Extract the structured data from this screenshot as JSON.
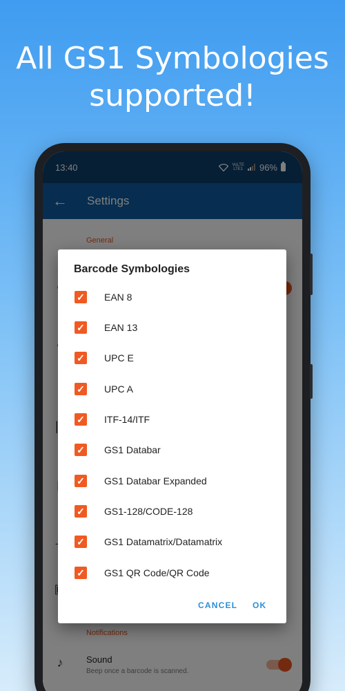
{
  "headline": {
    "line1": "All GS1 Symbologies",
    "line2": "supported!"
  },
  "status_bar": {
    "time": "13:40",
    "network_top": "VoLTE",
    "network_bottom": "LTE1",
    "battery": "96%"
  },
  "app_bar": {
    "title": "Settings"
  },
  "settings": {
    "section_general": "General",
    "section_notifications": "Notifications",
    "sound": {
      "title": "Sound",
      "subtitle": "Beep once a barcode is scanned."
    }
  },
  "dialog": {
    "title": "Barcode Symbologies",
    "options": [
      {
        "label": "EAN 8",
        "checked": true
      },
      {
        "label": "EAN 13",
        "checked": true
      },
      {
        "label": "UPC E",
        "checked": true
      },
      {
        "label": "UPC A",
        "checked": true
      },
      {
        "label": "ITF-14/ITF",
        "checked": true
      },
      {
        "label": "GS1 Databar",
        "checked": true
      },
      {
        "label": "GS1 Databar Expanded",
        "checked": true
      },
      {
        "label": "GS1-128/CODE-128",
        "checked": true
      },
      {
        "label": "GS1 Datamatrix/Datamatrix",
        "checked": true
      },
      {
        "label": "GS1 QR Code/QR Code",
        "checked": true
      }
    ],
    "cancel_label": "CANCEL",
    "ok_label": "OK"
  },
  "colors": {
    "accent": "#f05a22",
    "app_bar": "#0f5aa0",
    "status_bar": "#0c3e6a",
    "button_text": "#2b8fd6"
  }
}
